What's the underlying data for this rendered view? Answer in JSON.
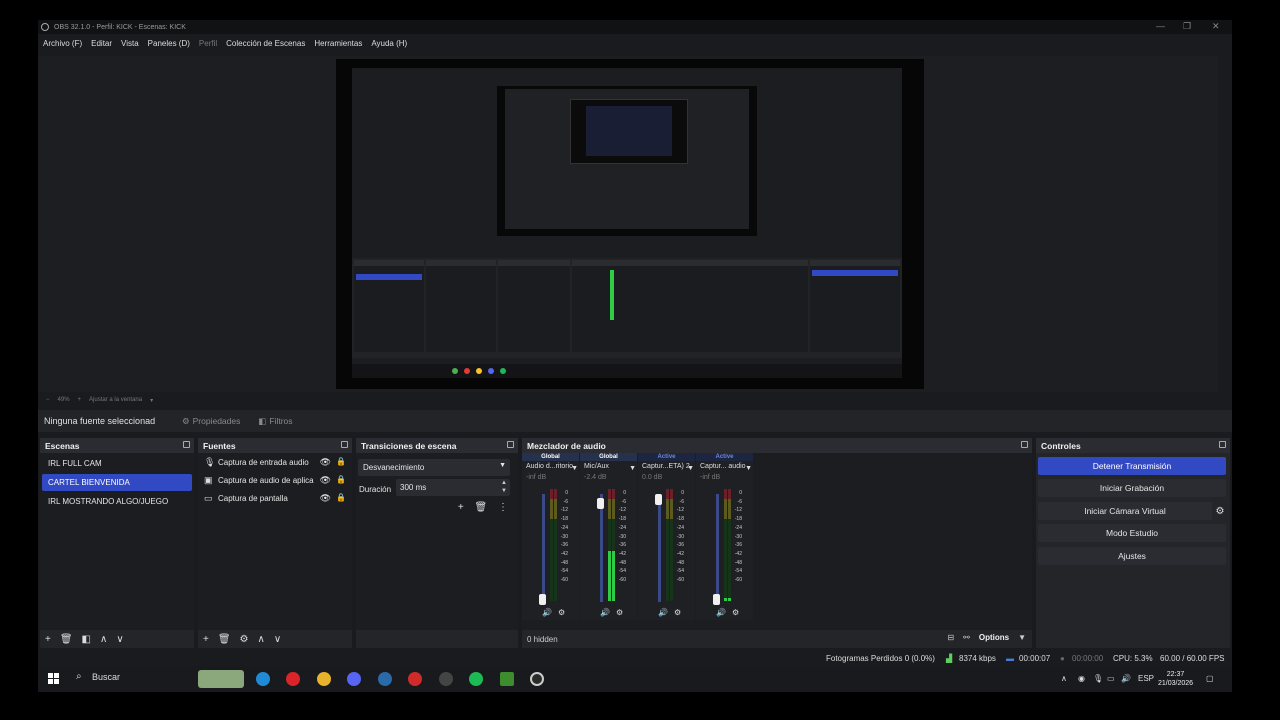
{
  "window": {
    "title": "OBS 32.1.0 - Perfil: KICK - Escenas: KICK",
    "minimize": "—",
    "maximize": "❐",
    "close": "✕"
  },
  "menubar": {
    "items": [
      "Archivo (F)",
      "Editar",
      "Vista",
      "Paneles (D)",
      "Perfil",
      "Colección de Escenas",
      "Herramientas",
      "Ayuda (H)"
    ]
  },
  "zoombar": {
    "minus": "−",
    "zoom": "49%",
    "plus": "+",
    "fit": "Ajustar a la ventana"
  },
  "sourcebar": {
    "no_source": "Ninguna fuente seleccionad",
    "properties": "Propiedades",
    "filters": "Filtros"
  },
  "scenes": {
    "title": "Escenas",
    "items": [
      "IRL FULL CAM",
      "CARTEL BIENVENIDA",
      "IRL MOSTRANDO ALGO/JUEGO"
    ],
    "active_index": 1
  },
  "sources": {
    "title": "Fuentes",
    "items": [
      {
        "label": "Captura de entrada audio",
        "icon": "microphone-icon"
      },
      {
        "label": "Captura de audio de aplica",
        "icon": "app-audio-icon"
      },
      {
        "label": "Captura de pantalla",
        "icon": "monitor-icon"
      }
    ]
  },
  "transitions": {
    "title": "Transiciones de escena",
    "selected": "Desvanecimiento",
    "duration_label": "Duración",
    "duration_value": "300 ms"
  },
  "mixer": {
    "title": "Mezclador de audio",
    "channels": [
      {
        "badge": "Global",
        "name": "Audio d...ritorio",
        "db": "-inf dB",
        "level": 0.0,
        "fader": 0.0
      },
      {
        "badge": "Global",
        "name": "Mic/Aux",
        "db": "-2.4 dB",
        "level": 0.45,
        "fader": 0.96
      },
      {
        "badge": "Active",
        "name": "Captur...ETA) 2",
        "db": "0.0 dB",
        "level": 0.0,
        "fader": 1.0
      },
      {
        "badge": "Active",
        "name": "Captur... audio",
        "db": "-inf dB",
        "level": 0.03,
        "fader": 0.0
      }
    ],
    "scale": [
      "0",
      "-6",
      "-12",
      "-18",
      "-24",
      "-30",
      "-36",
      "-42",
      "-48",
      "-54",
      "-60"
    ],
    "hidden": "0 hidden",
    "options": "Options"
  },
  "controls": {
    "title": "Controles",
    "stop_stream": "Detener Transmisión",
    "start_record": "Iniciar Grabación",
    "start_vcam": "Iniciar Cámara Virtual",
    "studio_mode": "Modo Estudio",
    "settings": "Ajustes"
  },
  "status": {
    "dropped": "Fotogramas Perdidos 0 (0.0%)",
    "bitrate": "8374 kbps",
    "stream_time": "00:00:07",
    "record_time": "00:00:00",
    "cpu": "CPU: 5.3%",
    "fps": "60.00 / 60.00 FPS"
  },
  "taskbar": {
    "search": "Buscar",
    "lang": "ESP",
    "time": "22:37",
    "date": "21/03/2026"
  },
  "colors": {
    "accent": "#3249c4",
    "meter_green": "#2fcc48",
    "meter_red": "#6b1f28",
    "meter_yellow": "#5d5a1d"
  }
}
